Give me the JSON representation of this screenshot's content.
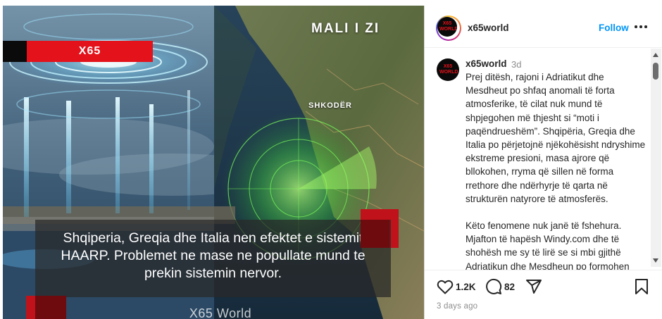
{
  "post": {
    "brand_tag": "X65",
    "map_country_label": "MALI I ZI",
    "map_city_label": "SHKODËR",
    "caption": "Shqiperia, Greqia dhe Italia nen efektet e sistemit HAARP. Problemet ne mase ne popullate mund te prekin sistemin nervor.",
    "footer_brand": "X65 World"
  },
  "header": {
    "avatar_text": "X65 WORLD",
    "username": "x65world",
    "follow_label": "Follow",
    "more_icon": "more-horizontal-icon"
  },
  "comment": {
    "avatar_text": "X65 WORLD",
    "username": "x65world",
    "time": "3d",
    "paragraph_1": "Prej ditësh, rajoni i Adriatikut dhe Mesdheut po shfaq anomali të forta atmosferike, të cilat nuk mund të shpjegohen më thjesht si “moti i paqëndrueshëm”. Shqipëria, Greqia dhe Italia po përjetojnë njëkohësisht ndryshime ekstreme presioni, masa ajrore që bllokohen, rryma që sillen në forma rrethore dhe ndërhyrje të qarta në strukturën natyrore të atmosferës.",
    "paragraph_2": "Këto fenomene nuk janë të fshehura. Mjafton të hapësh Windy.com dhe të shohësh me sy të lirë se si mbi gjithë Adriatikun dhe Mesdheun po formohen"
  },
  "actions": {
    "like_count": "1.2K",
    "comment_count": "82",
    "icons": [
      "heart-icon",
      "comment-icon",
      "share-icon",
      "bookmark-icon"
    ]
  },
  "time_ago": "3 days ago",
  "colors": {
    "brand_red": "#e3121b",
    "follow_blue": "#0095f6",
    "text": "#262626",
    "muted": "#8e8e8e"
  }
}
